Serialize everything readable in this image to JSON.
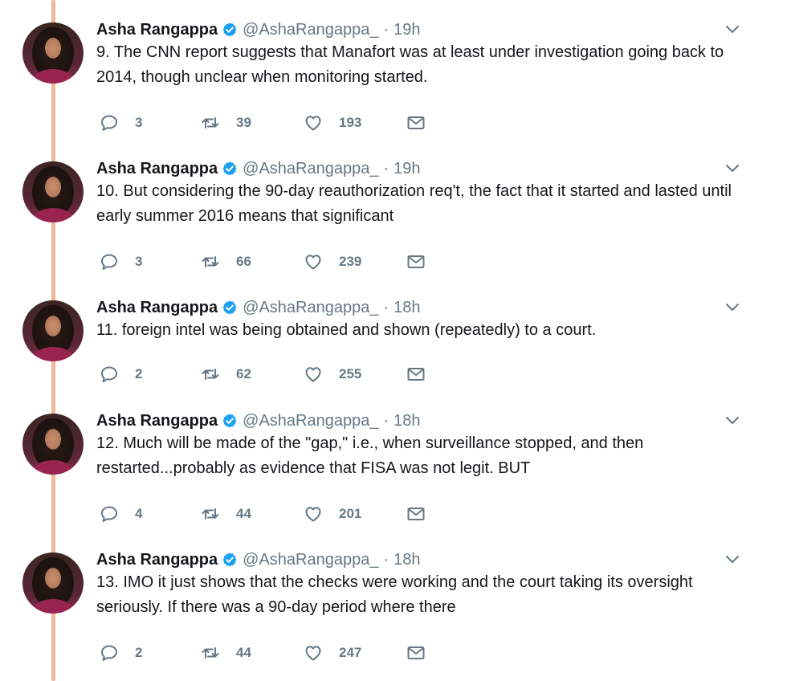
{
  "colors": {
    "accent": "#1da1f2",
    "thread_line": "#f3b79a",
    "secondary_text": "#657786"
  },
  "tweets": [
    {
      "name": "Asha Rangappa",
      "handle": "@AshaRangappa_",
      "dot": "·",
      "time": "19h",
      "text": "9. The CNN report suggests that Manafort was at least under investigation going back to 2014, though unclear when monitoring started.",
      "replies": "3",
      "retweets": "39",
      "likes": "193"
    },
    {
      "name": "Asha Rangappa",
      "handle": "@AshaRangappa_",
      "dot": "·",
      "time": "19h",
      "text": "10. But considering the 90-day reauthorization req't, the fact that it started and lasted until early summer 2016 means that significant",
      "replies": "3",
      "retweets": "66",
      "likes": "239"
    },
    {
      "name": "Asha Rangappa",
      "handle": "@AshaRangappa_",
      "dot": "·",
      "time": "18h",
      "text": "11. foreign intel was being obtained and shown (repeatedly) to a court.",
      "replies": "2",
      "retweets": "62",
      "likes": "255"
    },
    {
      "name": "Asha Rangappa",
      "handle": "@AshaRangappa_",
      "dot": "·",
      "time": "18h",
      "text": "12. Much will be made of the \"gap,\" i.e., when surveillance stopped, and then restarted...probably as evidence that FISA  was not legit. BUT",
      "replies": "4",
      "retweets": "44",
      "likes": "201"
    },
    {
      "name": "Asha Rangappa",
      "handle": "@AshaRangappa_",
      "dot": "·",
      "time": "18h",
      "text": "13. IMO it just shows that the checks were working and the court taking its oversight seriously. If there was a 90-day period where there",
      "replies": "2",
      "retweets": "44",
      "likes": "247"
    }
  ]
}
